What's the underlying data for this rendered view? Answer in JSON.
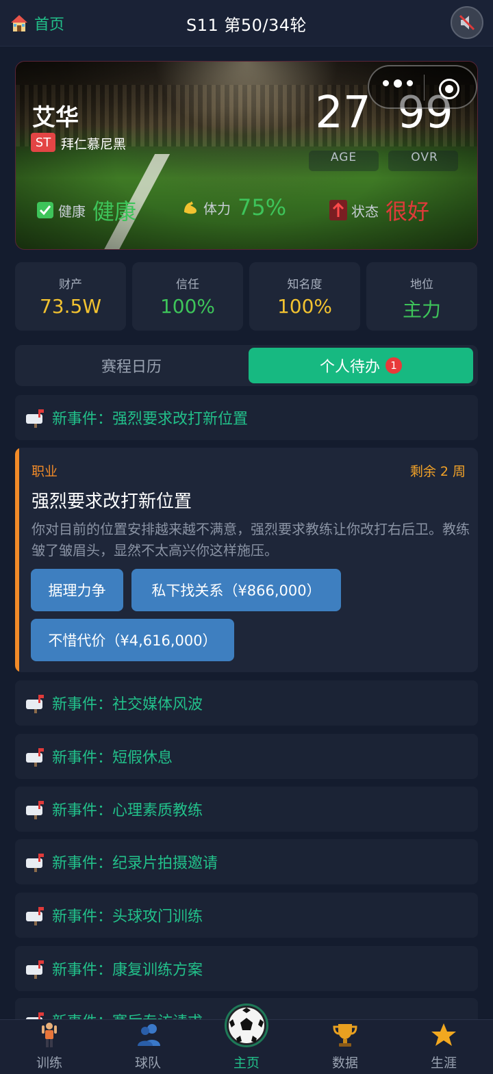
{
  "header": {
    "home_label": "首页",
    "title": "S11 第50/34轮",
    "icons": {
      "home": "house-icon",
      "mute": "speaker-muted-icon"
    }
  },
  "player": {
    "name": "艾华",
    "position": "ST",
    "club": "拜仁慕尼黑",
    "age": "27",
    "age_label": "AGE",
    "ovr": "99",
    "ovr_label": "OVR",
    "status": [
      {
        "label": "健康",
        "value": "健康",
        "icon": "check-icon",
        "color": "#3ec45a"
      },
      {
        "label": "体力",
        "value": "75%",
        "icon": "muscle-icon",
        "color": "#3ec45a"
      },
      {
        "label": "状态",
        "value": "很好",
        "icon": "arrow-up-icon",
        "color": "#e03a3a"
      }
    ]
  },
  "stats": [
    {
      "label": "财产",
      "value": "73.5W",
      "color": "#f2c230"
    },
    {
      "label": "信任",
      "value": "100%",
      "color": "#3ec45a"
    },
    {
      "label": "知名度",
      "value": "100%",
      "color": "#f2c230"
    },
    {
      "label": "地位",
      "value": "主力",
      "color": "#3ec45a"
    }
  ],
  "tabs": {
    "calendar": "赛程日历",
    "todo": "个人待办",
    "todo_badge": "1"
  },
  "events_top": [
    {
      "text": "新事件：强烈要求改打新位置"
    }
  ],
  "expanded_event": {
    "category": "职业",
    "remaining": "剩余 2 周",
    "title": "强烈要求改打新位置",
    "description": "你对目前的位置安排越来越不满意，强烈要求教练让你改打右后卫。教练皱了皱眉头，显然不太高兴你这样施压。",
    "buttons": [
      "据理力争",
      "私下找关系（¥866,000）",
      "不惜代价（¥4,616,000）"
    ]
  },
  "events": [
    {
      "text": "新事件：社交媒体风波"
    },
    {
      "text": "新事件：短假休息"
    },
    {
      "text": "新事件：心理素质教练"
    },
    {
      "text": "新事件：纪录片拍摄邀请"
    },
    {
      "text": "新事件：头球攻门训练"
    },
    {
      "text": "新事件：康复训练方案"
    },
    {
      "text": "新事件：赛后专访请求"
    }
  ],
  "nav": [
    {
      "label": "训练",
      "icon": "trainer-icon"
    },
    {
      "label": "球队",
      "icon": "team-icon"
    },
    {
      "label": "主页",
      "icon": "soccer-ball-icon",
      "active": true
    },
    {
      "label": "数据",
      "icon": "trophy-icon"
    },
    {
      "label": "生涯",
      "icon": "star-icon"
    }
  ],
  "colors": {
    "accent": "#22c08a",
    "warning": "#f28b28",
    "button": "#3e7fc0"
  }
}
